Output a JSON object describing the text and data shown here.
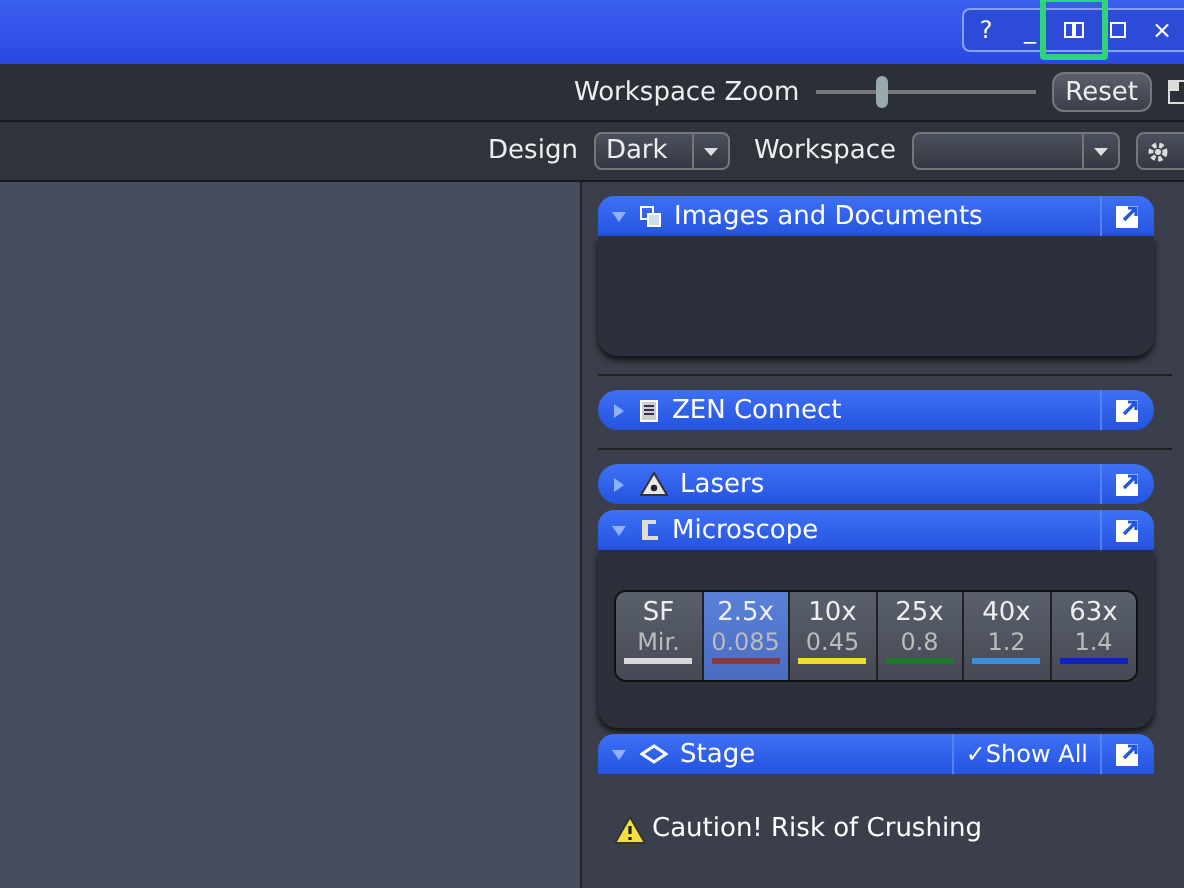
{
  "title_bar": {
    "buttons": [
      {
        "kind": "help",
        "label": "?",
        "highlighted": false
      },
      {
        "kind": "minimize",
        "label": "_",
        "highlighted": false
      },
      {
        "kind": "split",
        "highlighted": true
      },
      {
        "kind": "maximize",
        "highlighted": false
      },
      {
        "kind": "close",
        "label": "×",
        "highlighted": false
      }
    ]
  },
  "zoom_bar": {
    "label": "Workspace Zoom",
    "slider": {
      "level": 0.3
    },
    "reset": "Reset"
  },
  "design_bar": {
    "design_label": "Design",
    "design_value": "Dark",
    "workspace_label": "Workspace"
  },
  "tool_groups": [
    {
      "title": "Images and Documents",
      "kind": "documents",
      "expanded": true
    },
    {
      "title": "ZEN Connect",
      "kind": "connect",
      "expanded": false
    },
    {
      "title": "Lasers",
      "kind": "laser",
      "expanded": false
    },
    {
      "title": "Microscope",
      "kind": "microscope",
      "expanded": true,
      "objectives": [
        {
          "name": "SF",
          "value": "Mir.",
          "color": "#d8d8d8",
          "selected": false
        },
        {
          "name": "2.5x",
          "value": "0.085",
          "color": "#8a3a3a",
          "selected": true
        },
        {
          "name": "10x",
          "value": "0.45",
          "color": "#f0e020",
          "selected": false
        },
        {
          "name": "25x",
          "value": "0.8",
          "color": "#1e7a2a",
          "selected": false
        },
        {
          "name": "40x",
          "value": "1.2",
          "color": "#3a8ee0",
          "selected": false
        },
        {
          "name": "63x",
          "value": "1.4",
          "color": "#1020c8",
          "selected": false
        }
      ]
    },
    {
      "title": "Stage",
      "kind": "stage",
      "expanded": true,
      "show_all": "✓Show All",
      "warning": "Caution! Risk of Crushing"
    }
  ]
}
